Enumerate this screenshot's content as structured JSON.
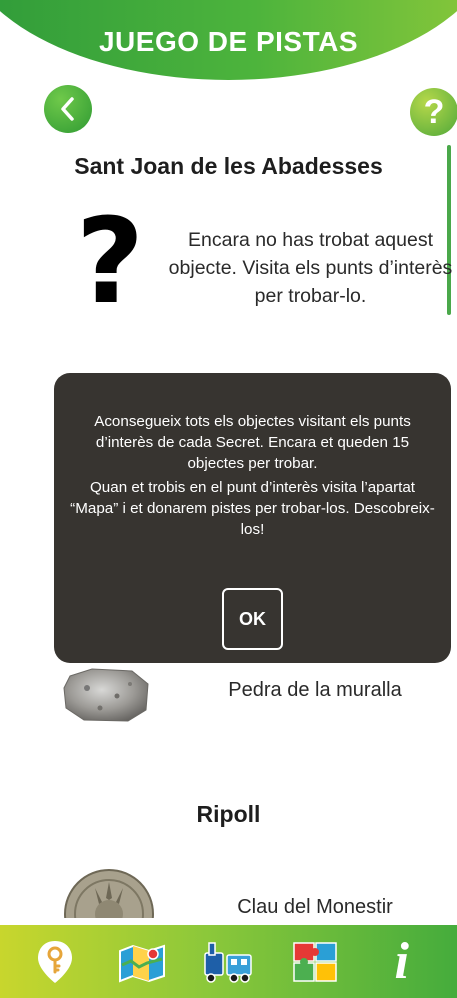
{
  "header": {
    "title": "JUEGO DE PISTAS"
  },
  "controls": {
    "help_symbol": "?"
  },
  "sections": [
    {
      "title": "Sant Joan de les Abadesses",
      "items": [
        {
          "symbol": "?",
          "description": "Encara no has trobat aquest objecte. Visita els punts d’interès per trobar-lo.",
          "found": false
        },
        {
          "label": "Pedra de la muralla",
          "found": true
        }
      ]
    },
    {
      "title": "Ripoll",
      "items": [
        {
          "label": "Clau del Monestir",
          "found": true
        }
      ]
    }
  ],
  "modal": {
    "paragraph1": "Aconsegueix tots els objectes visitant els punts d’interès de cada Secret. Encara et queden 15 objectes per trobar.",
    "paragraph2": "Quan et trobis en el punt d’interès visita l’apartat “Mapa” i et donarem pistes per trobar-los. Descobreix-los!",
    "ok_label": "OK"
  },
  "bottom_nav": {
    "items": [
      {
        "icon": "location-key-icon"
      },
      {
        "icon": "map-icon"
      },
      {
        "icon": "train-icon"
      },
      {
        "icon": "puzzle-icon"
      },
      {
        "icon": "info-icon",
        "symbol": "i"
      }
    ]
  },
  "colors": {
    "header_green": "#4db43c",
    "modal_bg": "#373430",
    "nav_gradient_start": "#c8d62d",
    "nav_gradient_end": "#45ac3c"
  }
}
